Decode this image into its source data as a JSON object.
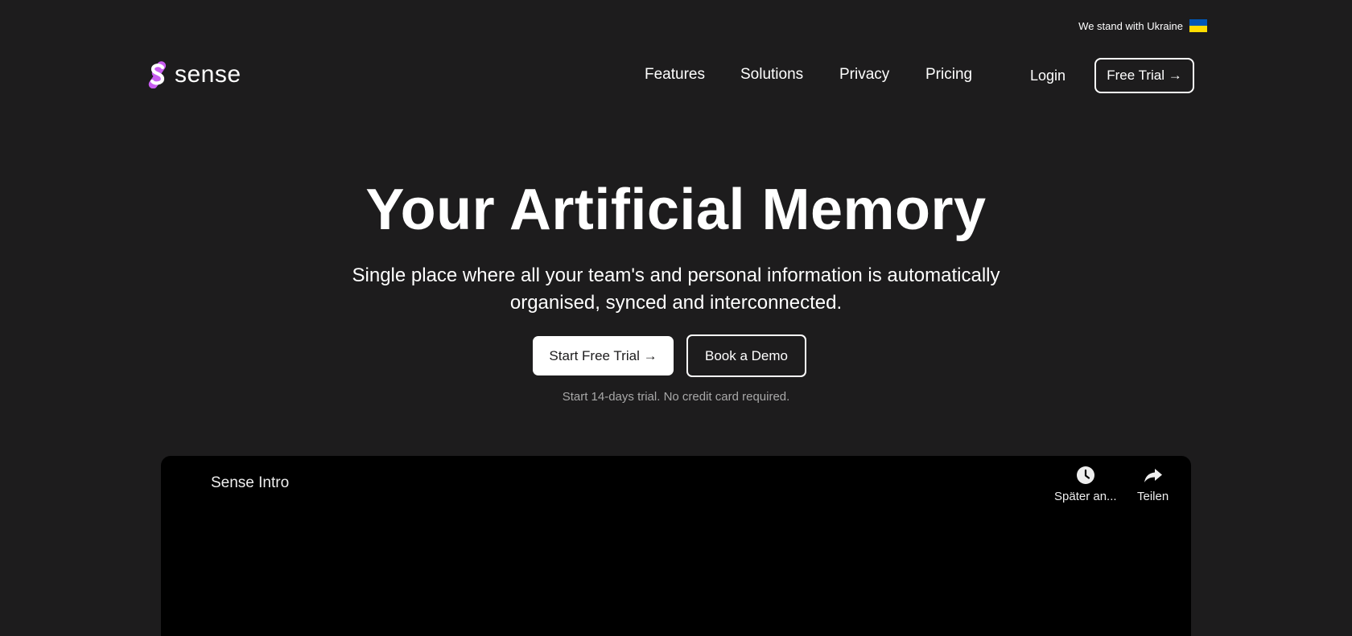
{
  "banner": {
    "text": "We stand with Ukraine",
    "flag_colors": {
      "top": "#0057b7",
      "bottom": "#ffdd00"
    }
  },
  "header": {
    "brand": "sense",
    "brand_accent": "#c85cf0",
    "nav": [
      {
        "label": "Features"
      },
      {
        "label": "Solutions"
      },
      {
        "label": "Privacy"
      },
      {
        "label": "Pricing"
      }
    ],
    "login_label": "Login",
    "free_trial_label": "Free Trial →"
  },
  "hero": {
    "title": "Your Artificial Memory",
    "subtitle_line1": "Single place where all your team's and personal information is automatically",
    "subtitle_line2": "organised, synced and interconnected.",
    "primary_cta": "Start Free Trial →",
    "secondary_cta": "Book a Demo",
    "note": "Start 14-days trial. No credit card required."
  },
  "video": {
    "title": "Sense Intro",
    "actions": [
      {
        "icon": "clock-icon",
        "label": "Später an..."
      },
      {
        "icon": "share-icon",
        "label": "Teilen"
      }
    ]
  }
}
